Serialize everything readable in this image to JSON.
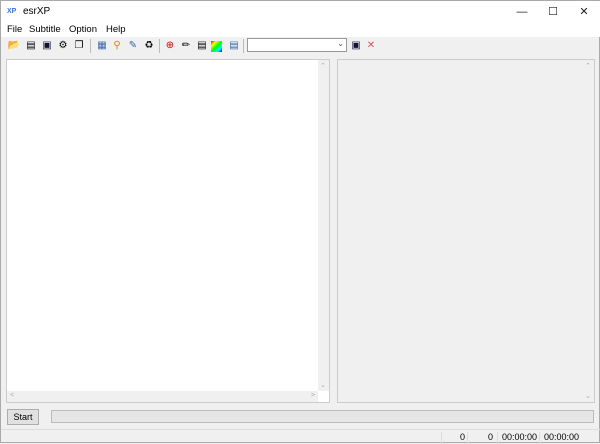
{
  "app": {
    "title": "esrXP",
    "icon": "XP"
  },
  "window_controls": [
    "minimize",
    "maximize",
    "close"
  ],
  "menu": [
    "File",
    "Subtitle",
    "Option",
    "Help"
  ],
  "toolbar": {
    "icons": [
      "open-folder-icon",
      "import-icon",
      "save-icon",
      "settings-icon",
      "copy-icon",
      "video-icon",
      "find-icon",
      "edit-icon",
      "trash-icon",
      "zoom-in-icon",
      "tool-icon",
      "document-icon",
      "color-icon",
      "export-icon"
    ],
    "combo_value": "",
    "save_icon": "save-icon",
    "clear_icon": "close-x-icon",
    "clear_color": "#e05050"
  },
  "controls": {
    "start_label": "Start",
    "progress": 0
  },
  "status": {
    "field1": "0",
    "field2": "0",
    "time1": "00:00:00",
    "time2": "00:00:00"
  }
}
